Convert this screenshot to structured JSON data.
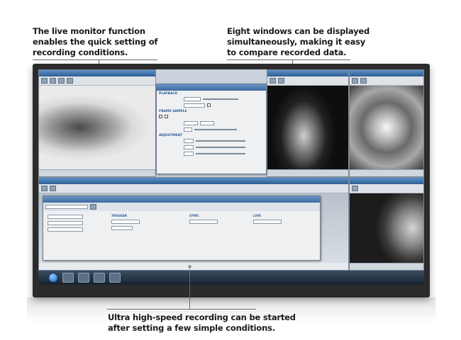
{
  "callouts": {
    "top_left": [
      "The live monitor function",
      "enables the quick setting of",
      "recording conditions."
    ],
    "top_right": [
      "Eight windows can be displayed",
      "simultaneously, making it easy",
      "to compare recorded data."
    ],
    "bottom": [
      "Ultra high-speed recording can be started",
      "after setting a few simple conditions."
    ]
  },
  "screen": {
    "taskbar_clock": "",
    "playback_panel": {
      "sections": [
        "PLAYBACK",
        "FRAME SAMPLE",
        "ADJUSTMENT"
      ]
    },
    "settings_panel": {
      "sections": [
        "TRIGGER",
        "SYNC",
        "LIVE"
      ]
    }
  }
}
